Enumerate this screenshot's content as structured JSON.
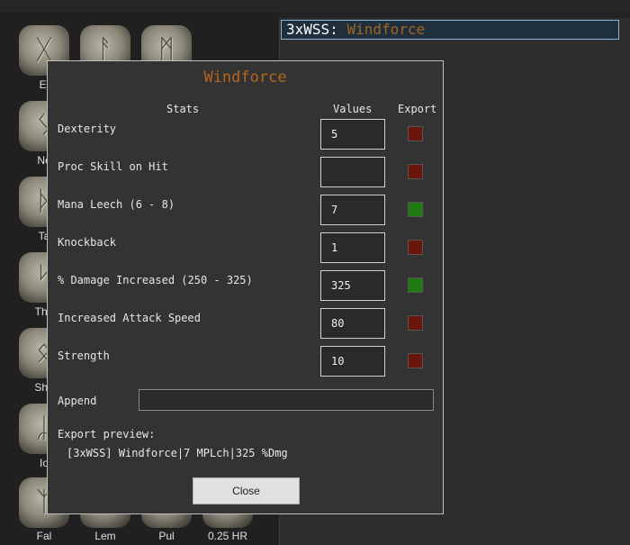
{
  "header": {
    "title_prefix": "3xWSS:",
    "title_item": "Windforce"
  },
  "runes": [
    {
      "label": "El",
      "glyph": "ᚷ"
    },
    {
      "label": "",
      "glyph": "ᚨ"
    },
    {
      "label": "",
      "glyph": "ᛗ"
    },
    {
      "label": "Ne",
      "glyph": "ᛊ"
    },
    {
      "label": "Ta",
      "glyph": "ᚦ"
    },
    {
      "label": "Thu",
      "glyph": "ᛋ"
    },
    {
      "label": "Sha",
      "glyph": "ᛟ"
    },
    {
      "label": "Io",
      "glyph": "ᛦ"
    },
    {
      "label": "Fal",
      "glyph": "ᛉ"
    },
    {
      "label": "Lem",
      "glyph": "ᛞ"
    },
    {
      "label": "Pul",
      "glyph": "ᛏ"
    },
    {
      "label": "0.25 HR",
      "glyph": "ᛜ"
    }
  ],
  "modal": {
    "title": "Windforce",
    "col_stats": "Stats",
    "col_values": "Values",
    "col_export": "Export",
    "stats": [
      {
        "label": "Dexterity",
        "value": "5",
        "export": false
      },
      {
        "label": "Proc Skill on Hit",
        "value": "",
        "export": false
      },
      {
        "label": "Mana Leech (6 - 8)",
        "value": "7",
        "export": true
      },
      {
        "label": "Knockback",
        "value": "1",
        "export": false
      },
      {
        "label": "% Damage Increased (250 - 325)",
        "value": "325",
        "export": true
      },
      {
        "label": "Increased Attack Speed",
        "value": "80",
        "export": false
      },
      {
        "label": "Strength",
        "value": "10",
        "export": false
      }
    ],
    "append_label": "Append",
    "append_value": "",
    "preview_label": "Export preview:",
    "preview_text": "[3xWSS] Windforce|7 MPLch|325 %Dmg",
    "close_label": "Close"
  },
  "colors": {
    "export_on": "#1f7a12",
    "export_off": "#6b160c",
    "item_name": "#b4661c"
  }
}
